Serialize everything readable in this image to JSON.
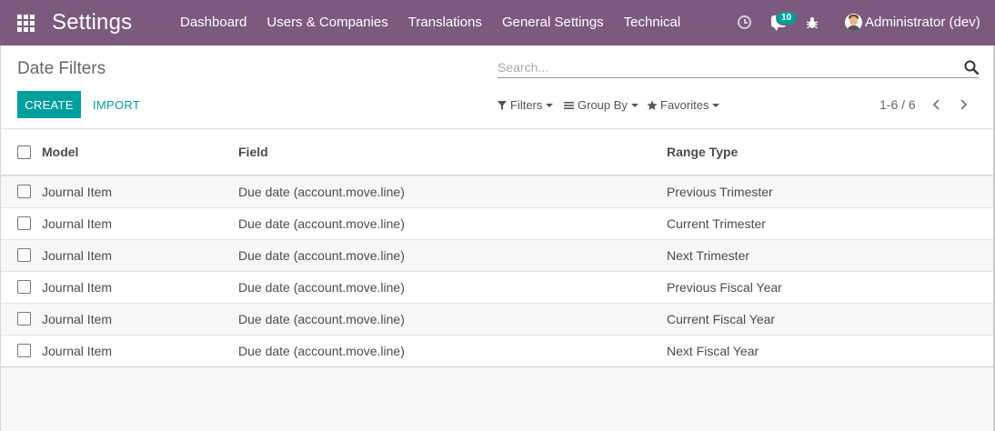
{
  "navbar": {
    "app_title": "Settings",
    "menu": [
      "Dashboard",
      "Users & Companies",
      "Translations",
      "General Settings",
      "Technical"
    ],
    "notification_count": "10",
    "user_name": "Administrator (dev)",
    "color": "#7c5a7e"
  },
  "control_panel": {
    "breadcrumb": "Date Filters",
    "search_placeholder": "Search...",
    "create_label": "CREATE",
    "import_label": "IMPORT",
    "filters_label": "Filters",
    "group_by_label": "Group By",
    "favorites_label": "Favorites",
    "pager": "1-6 / 6",
    "accent": "#00a09d"
  },
  "list": {
    "columns": [
      "Model",
      "Field",
      "Range Type"
    ],
    "rows": [
      [
        "Journal Item",
        "Due date (account.move.line)",
        "Previous Trimester"
      ],
      [
        "Journal Item",
        "Due date (account.move.line)",
        "Current Trimester"
      ],
      [
        "Journal Item",
        "Due date (account.move.line)",
        "Next Trimester"
      ],
      [
        "Journal Item",
        "Due date (account.move.line)",
        "Previous Fiscal Year"
      ],
      [
        "Journal Item",
        "Due date (account.move.line)",
        "Current Fiscal Year"
      ],
      [
        "Journal Item",
        "Due date (account.move.line)",
        "Next Fiscal Year"
      ]
    ]
  },
  "icons": [
    "apps-grid-icon",
    "clock-icon",
    "chat-icon",
    "bug-icon",
    "avatar",
    "search-icon",
    "filter-icon",
    "list-icon",
    "star-icon",
    "chevron-left-icon",
    "chevron-right-icon"
  ]
}
